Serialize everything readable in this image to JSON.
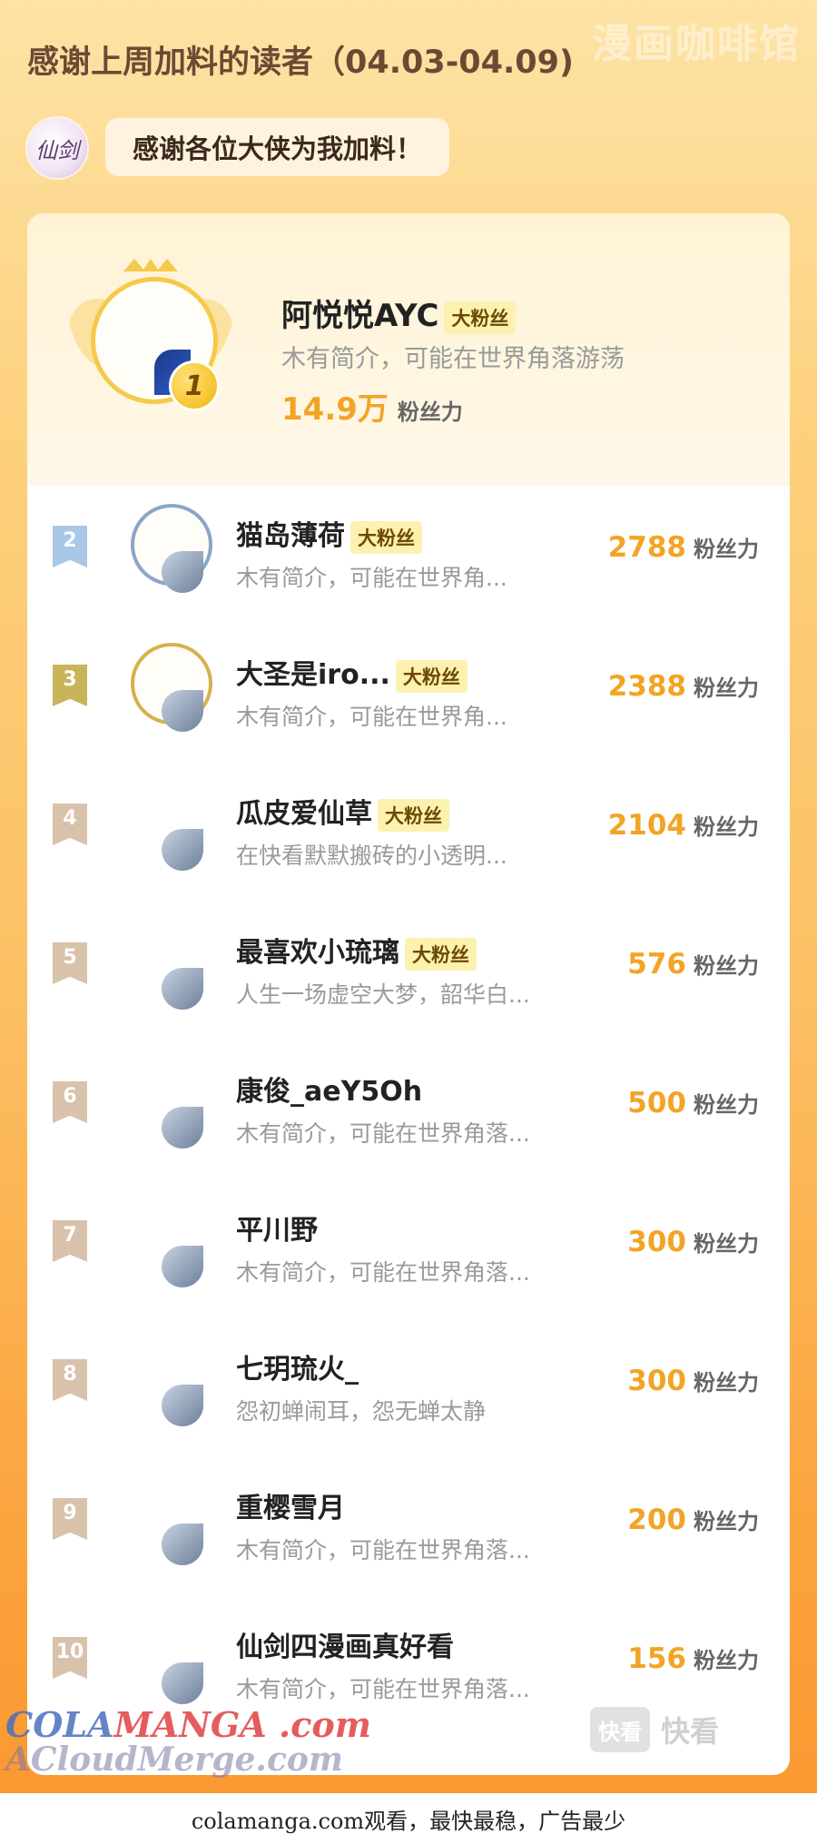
{
  "watermark_top": "漫画咖啡馆",
  "header": {
    "title": "感谢上周加料的读者（04.03-04.09)",
    "host_avatar_text": "仙剑",
    "thanks_message": "感谢各位大侠为我加料！"
  },
  "top_reader": {
    "rank": "1",
    "name": "阿悦悦AYC",
    "badge": "大粉丝",
    "bio": "木有简介，可能在世界角落游荡",
    "fan_power": "14.9万",
    "fan_power_unit": "粉丝力"
  },
  "readers": [
    {
      "rank": "2",
      "name": "猫岛薄荷",
      "badge": "大粉丝",
      "bio": "木有简介，可能在世界角...",
      "fan_power": "2788",
      "unit": "粉丝力"
    },
    {
      "rank": "3",
      "name": "大圣是iro...",
      "badge": "大粉丝",
      "bio": "木有简介，可能在世界角...",
      "fan_power": "2388",
      "unit": "粉丝力"
    },
    {
      "rank": "4",
      "name": "瓜皮爱仙草",
      "badge": "大粉丝",
      "bio": "在快看默默搬砖的小透明...",
      "fan_power": "2104",
      "unit": "粉丝力"
    },
    {
      "rank": "5",
      "name": "最喜欢小琉璃",
      "badge": "大粉丝",
      "bio": "人生一场虚空大梦，韶华白...",
      "fan_power": "576",
      "unit": "粉丝力"
    },
    {
      "rank": "6",
      "name": "康俊_aeY5Oh",
      "badge": "",
      "bio": "木有简介，可能在世界角落...",
      "fan_power": "500",
      "unit": "粉丝力"
    },
    {
      "rank": "7",
      "name": "平川野",
      "badge": "",
      "bio": "木有简介，可能在世界角落...",
      "fan_power": "300",
      "unit": "粉丝力"
    },
    {
      "rank": "8",
      "name": "七玥琉火_",
      "badge": "",
      "bio": "怨初蝉闹耳，怨无蝉太静",
      "fan_power": "300",
      "unit": "粉丝力"
    },
    {
      "rank": "9",
      "name": "重樱雪月",
      "badge": "",
      "bio": "木有简介，可能在世界角落...",
      "fan_power": "200",
      "unit": "粉丝力"
    },
    {
      "rank": "10",
      "name": "仙剑四漫画真好看",
      "badge": "",
      "bio": "木有简介，可能在世界角落...",
      "fan_power": "156",
      "unit": "粉丝力"
    }
  ],
  "watermarks": {
    "brand_line1_a": "COLA",
    "brand_line1_b": "MANGA",
    "brand_line1_c": " .com",
    "brand_line2": "ACloudMerge.com",
    "kuaikan_box": "快看",
    "kuaikan_text": "快看"
  },
  "footer": {
    "text": "colamanga.com观看，最快最稳，广告最少"
  },
  "colors": {
    "accent_orange": "#f2a425",
    "badge_bg": "#fdf1b0",
    "rank_silver": "#a9c7e6",
    "rank_gold": "#c9b45a",
    "rank_default": "#d9c2ac"
  }
}
